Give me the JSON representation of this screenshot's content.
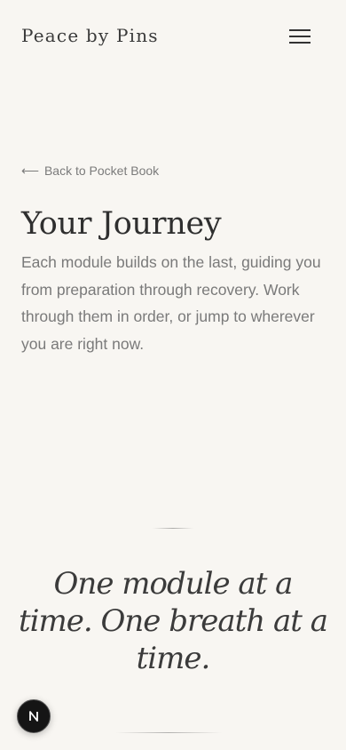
{
  "header": {
    "brand": "Peace by Pins",
    "menu_icon": "hamburger-menu-icon"
  },
  "back_link": {
    "arrow": "⟵",
    "label": "Back to Pocket Book"
  },
  "page": {
    "title": "Your Journey",
    "intro": "Each module builds on the last, guiding you from preparation through recovery. Work through them in order, or jump to wherever you are right now."
  },
  "quote": {
    "text": "One module at a time. One breath at a time."
  },
  "floating_badge": {
    "icon": "nextjs-n-icon",
    "background": "#151515"
  },
  "colors": {
    "background": "#f8f6f2",
    "heading": "#2f2f2f",
    "body_text": "#7a7a7a"
  }
}
